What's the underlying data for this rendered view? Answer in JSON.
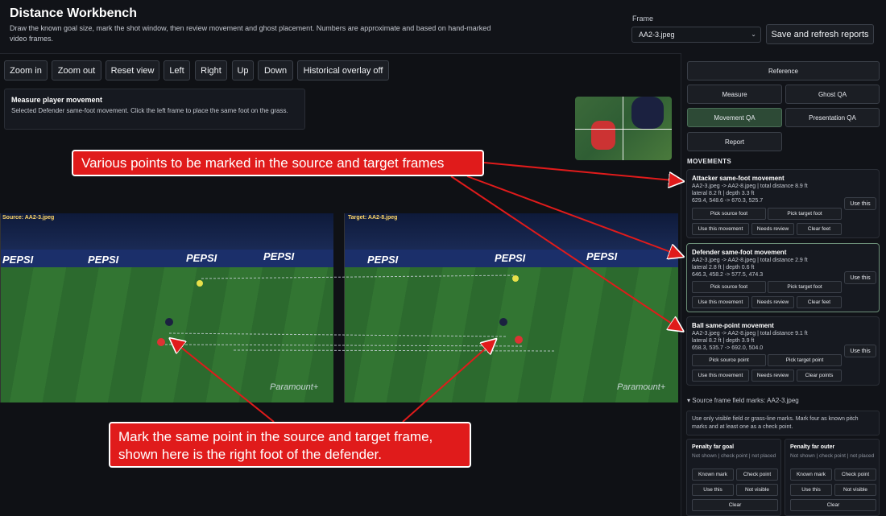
{
  "header": {
    "title": "Distance Workbench",
    "description": "Draw the known goal size, mark the shot window, then review movement and ghost placement. Numbers are approximate and based on hand-marked video frames.",
    "frame_label": "Frame",
    "frame_value": "AA2-3.jpeg",
    "save_label": "Save and refresh reports"
  },
  "toolbar": {
    "zoom_in": "Zoom in",
    "zoom_out": "Zoom out",
    "reset_view": "Reset view",
    "left": "Left",
    "right": "Right",
    "up": "Up",
    "down": "Down",
    "overlay": "Historical overlay off"
  },
  "measure": {
    "title": "Measure player movement",
    "text": "Selected Defender same-foot movement. Click the left frame to place the same foot on the grass."
  },
  "frames": {
    "source_label": "Source: AA2-3.jpeg",
    "target_label": "Target: AA2-8.jpeg",
    "board_text": "PEPSI",
    "watermark": "Paramount+"
  },
  "nav": {
    "reference": "Reference",
    "measure": "Measure",
    "ghost_qa": "Ghost QA",
    "movement_qa": "Movement QA",
    "presentation_qa": "Presentation QA",
    "report": "Report"
  },
  "movements": {
    "heading": "MOVEMENTS",
    "items": [
      {
        "title": "Attacker same-foot movement",
        "line1": "AA2-3.jpeg -> AA2-8.jpeg | total distance 8.9 ft",
        "line2": "lateral 8.2 ft | depth 3.3 ft",
        "line3": "629.4, 548.6 -> 670.3, 525.7",
        "pick_source": "Pick source foot",
        "pick_target": "Pick target foot",
        "use_movement": "Use this movement",
        "needs_review": "Needs review",
        "clear": "Clear feet",
        "use_this": "Use this"
      },
      {
        "title": "Defender same-foot movement",
        "line1": "AA2-3.jpeg -> AA2-8.jpeg | total distance 2.9 ft",
        "line2": "lateral 2.8 ft | depth 0.6 ft",
        "line3": "646.3, 458.2 -> 577.5, 474.3",
        "pick_source": "Pick source foot",
        "pick_target": "Pick target foot",
        "use_movement": "Use this movement",
        "needs_review": "Needs review",
        "clear": "Clear feet",
        "use_this": "Use this"
      },
      {
        "title": "Ball same-point movement",
        "line1": "AA2-3.jpeg -> AA2-8.jpeg | total distance 9.1 ft",
        "line2": "lateral 8.2 ft | depth 3.9 ft",
        "line3": "658.3, 535.7 -> 692.0, 504.0",
        "pick_source": "Pick source point",
        "pick_target": "Pick target point",
        "use_movement": "Use this movement",
        "needs_review": "Needs review",
        "clear": "Clear points",
        "use_this": "Use this"
      }
    ]
  },
  "field_marks": {
    "heading": "▾ Source frame field marks: AA2-3.jpeg",
    "note": "Use only visible field or grass-line marks. Mark four as known pitch marks and at least one as a check point.",
    "cards": [
      {
        "title": "Penalty far goal",
        "status": "Not shown | check point | not placed",
        "known": "Known mark",
        "check": "Check point",
        "use": "Use this",
        "not_visible": "Not visible",
        "clear": "Clear"
      },
      {
        "title": "Penalty far outer",
        "status": "Not shown | check point | not placed",
        "known": "Known mark",
        "check": "Check point",
        "use": "Use this",
        "not_visible": "Not visible",
        "clear": "Clear"
      }
    ]
  },
  "annotations": {
    "callout_top": "Various points to be marked in the source and target frames",
    "callout_bottom": "Mark the same point in the source and target frame, shown here is the right foot of the defender."
  },
  "colors": {
    "background": "#0f1115",
    "active_tab": "#2d4a36",
    "callout": "#e01b1b"
  }
}
